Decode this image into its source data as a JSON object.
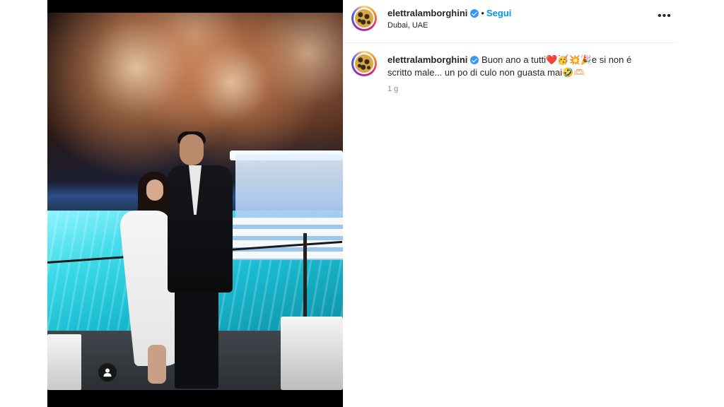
{
  "post": {
    "username": "elettralamborghini",
    "follow_label": "Segui",
    "separator": "•",
    "location": "Dubai, UAE",
    "more_label": "•••"
  },
  "caption": {
    "username": "elettralamborghini",
    "line1": "Buon ano a tutti❤️🥳💥🎉e si non é",
    "line2": "scritto male... un po di culo non guasta mai🤣🫶🏻",
    "time": "1 g"
  },
  "icons": {
    "verified": "verified-badge-icon",
    "more": "more-options-icon",
    "user_tag": "user-tag-icon"
  },
  "colors": {
    "accent": "#0095f6",
    "verified": "#3897f0",
    "muted": "#8e8e8e"
  }
}
